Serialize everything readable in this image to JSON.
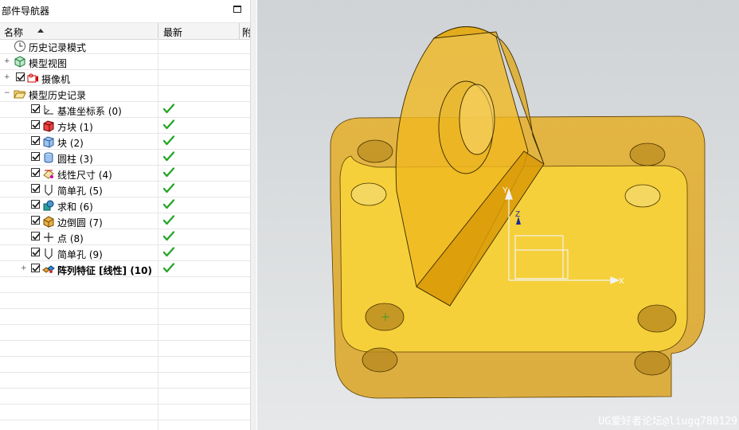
{
  "navigator": {
    "title": "部件导航器",
    "columns": {
      "name": "名称",
      "latest": "最新",
      "extra": "附"
    },
    "rows": [
      {
        "label": "历史记录模式",
        "indent": 0,
        "checked": false,
        "latest": false,
        "icon": "history-clock-icon"
      },
      {
        "label": "模型视图",
        "indent": 0,
        "checked": false,
        "latest": false,
        "icon": "model-view-icon",
        "expander": "+"
      },
      {
        "label": "摄像机",
        "indent": 0,
        "checked": true,
        "latest": false,
        "icon": "camera-icon",
        "expander": "+"
      },
      {
        "label": "模型历史记录",
        "indent": 0,
        "checked": false,
        "latest": false,
        "icon": "folder-open-icon",
        "expander": "−"
      },
      {
        "label": "基准坐标系 (0)",
        "indent": 1,
        "checked": true,
        "latest": true,
        "icon": "datum-csys-icon"
      },
      {
        "label": "方块 (1)",
        "indent": 1,
        "checked": true,
        "latest": true,
        "icon": "block-red-icon"
      },
      {
        "label": "块 (2)",
        "indent": 1,
        "checked": true,
        "latest": true,
        "icon": "block-icon"
      },
      {
        "label": "圆柱 (3)",
        "indent": 1,
        "checked": true,
        "latest": true,
        "icon": "cylinder-icon"
      },
      {
        "label": "线性尺寸 (4)",
        "indent": 1,
        "checked": true,
        "latest": true,
        "icon": "linear-dimension-icon"
      },
      {
        "label": "简单孔 (5)",
        "indent": 1,
        "checked": true,
        "latest": true,
        "icon": "simple-hole-icon"
      },
      {
        "label": "求和 (6)",
        "indent": 1,
        "checked": true,
        "latest": true,
        "icon": "unite-icon"
      },
      {
        "label": "边倒圆 (7)",
        "indent": 1,
        "checked": true,
        "latest": true,
        "icon": "edge-blend-icon"
      },
      {
        "label": "点 (8)",
        "indent": 1,
        "checked": true,
        "latest": true,
        "icon": "point-icon"
      },
      {
        "label": "简单孔 (9)",
        "indent": 1,
        "checked": true,
        "latest": true,
        "icon": "simple-hole-icon"
      },
      {
        "label": "阵列特征 [线性] (10)",
        "indent": 1,
        "checked": true,
        "latest": true,
        "icon": "pattern-feature-icon",
        "expander": "+",
        "bold": true
      }
    ]
  },
  "viewport": {
    "axes": {
      "x": "X",
      "y": "Y",
      "z": "Z"
    },
    "watermark": "UG爱好者论坛@liugq780129"
  },
  "colors": {
    "part_fill": "#f2c12e",
    "part_edge": "#3a2a00",
    "check_green": "#2aa52a",
    "viewport_bg": "#d3d6d8"
  }
}
